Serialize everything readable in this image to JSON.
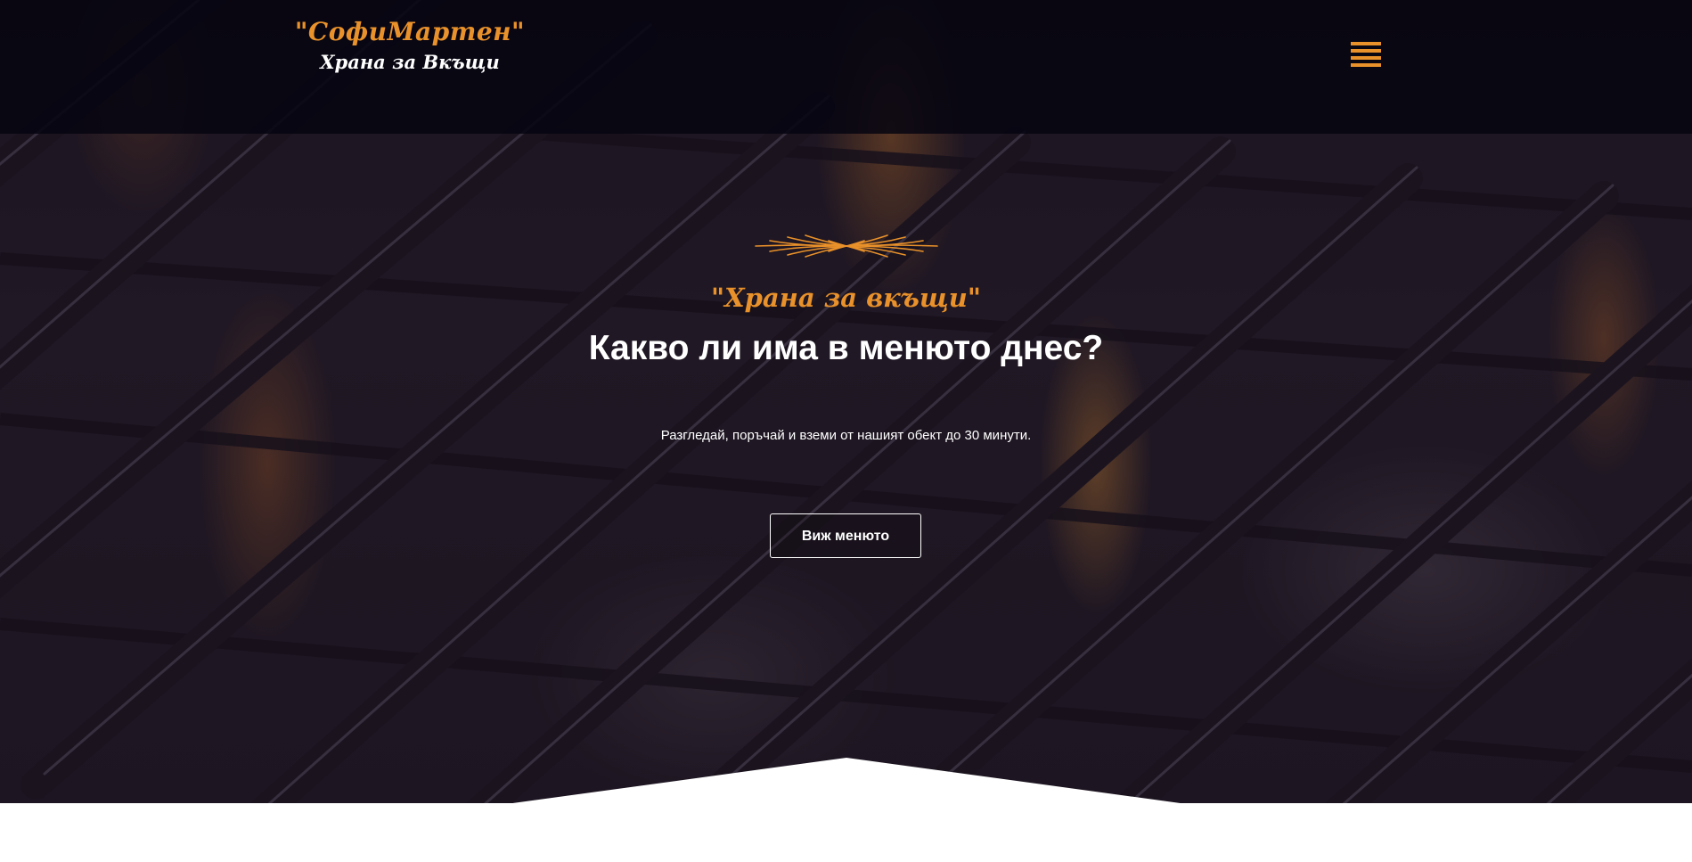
{
  "header": {
    "logo_name": "\"СофиМартен\"",
    "logo_tagline": "Храна за Вкъщи",
    "menu_icon": "hamburger-menu-icon"
  },
  "hero": {
    "ornament_icon": "wheat-ornament-icon",
    "script_heading": "\"Храна за вкъщи\"",
    "title": "Какво ли има в менюто днес?",
    "subtitle": "Разгледай, поръчай и вземи от нашият обект до 30 минути.",
    "cta_label": "Виж менюто",
    "background": "grill-over-flames"
  },
  "colors": {
    "accent": "#e9912a",
    "header_bg": "#060510",
    "text": "#ffffff",
    "page_bg": "#ffffff"
  }
}
